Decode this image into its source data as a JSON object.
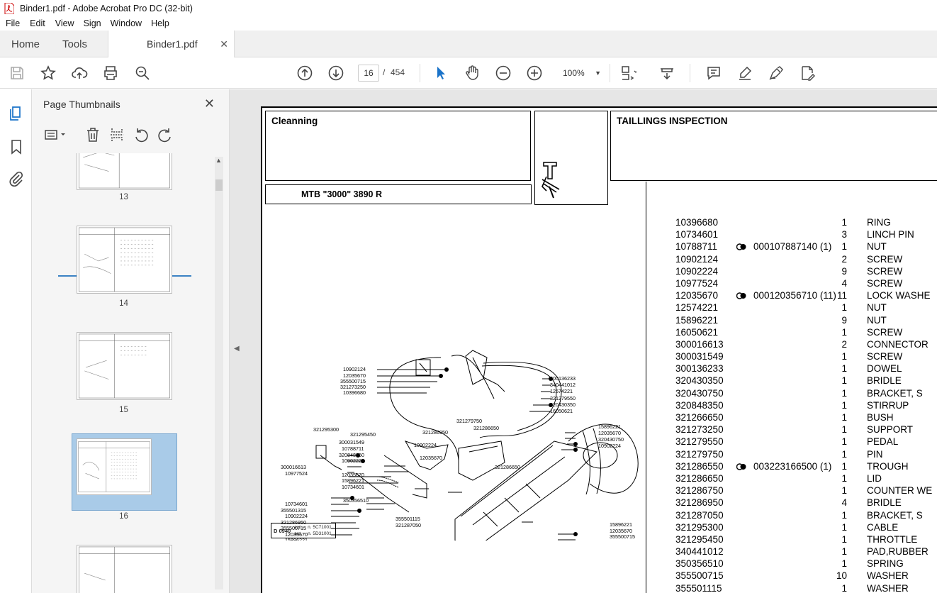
{
  "window": {
    "title": "Binder1.pdf - Adobe Acrobat Pro DC (32-bit)"
  },
  "menu": [
    "File",
    "Edit",
    "View",
    "Sign",
    "Window",
    "Help"
  ],
  "tabs": {
    "home": "Home",
    "tools": "Tools",
    "document": "Binder1.pdf"
  },
  "toolbar": {
    "current_page": "16",
    "separator": "/",
    "total_pages": "454",
    "zoom": "100%"
  },
  "panel": {
    "title": "Page Thumbnails",
    "thumbnails": [
      {
        "label": "13",
        "selected": false
      },
      {
        "label": "14",
        "selected": false
      },
      {
        "label": "15",
        "selected": false
      },
      {
        "label": "16",
        "selected": true
      },
      {
        "label": "",
        "selected": false
      }
    ]
  },
  "doc": {
    "section": "Cleanning",
    "heading": "TAILLINGS INSPECTION",
    "model": "MTB \"3000\" 3890 R",
    "drawing_code": "D 0940",
    "drawing_notes": [
      "aut.→ n. 5C71001",
      "aut.→ n. 5D31001"
    ],
    "parts": [
      {
        "pn": "10396680",
        "mark": false,
        "sub": "",
        "qty": "1",
        "desc": "RING"
      },
      {
        "pn": "10734601",
        "mark": false,
        "sub": "",
        "qty": "3",
        "desc": "LINCH PIN"
      },
      {
        "pn": "10788711",
        "mark": true,
        "sub": "000107887140  (1)",
        "qty": "1",
        "desc": "NUT"
      },
      {
        "pn": "10902124",
        "mark": false,
        "sub": "",
        "qty": "2",
        "desc": "SCREW"
      },
      {
        "pn": "10902224",
        "mark": false,
        "sub": "",
        "qty": "9",
        "desc": "SCREW"
      },
      {
        "pn": "10977524",
        "mark": false,
        "sub": "",
        "qty": "4",
        "desc": "SCREW"
      },
      {
        "pn": "12035670",
        "mark": true,
        "sub": "000120356710  (11)",
        "qty": "11",
        "desc": "LOCK WASHE"
      },
      {
        "pn": "12574221",
        "mark": false,
        "sub": "",
        "qty": "1",
        "desc": "NUT"
      },
      {
        "pn": "15896221",
        "mark": false,
        "sub": "",
        "qty": "9",
        "desc": "NUT"
      },
      {
        "pn": "16050621",
        "mark": false,
        "sub": "",
        "qty": "1",
        "desc": "SCREW"
      },
      {
        "pn": "300016613",
        "mark": false,
        "sub": "",
        "qty": "2",
        "desc": "CONNECTOR"
      },
      {
        "pn": "300031549",
        "mark": false,
        "sub": "",
        "qty": "1",
        "desc": "SCREW"
      },
      {
        "pn": "300136233",
        "mark": false,
        "sub": "",
        "qty": "1",
        "desc": "DOWEL"
      },
      {
        "pn": "320430350",
        "mark": false,
        "sub": "",
        "qty": "1",
        "desc": "BRIDLE"
      },
      {
        "pn": "320430750",
        "mark": false,
        "sub": "",
        "qty": "1",
        "desc": "BRACKET, S"
      },
      {
        "pn": "320848350",
        "mark": false,
        "sub": "",
        "qty": "1",
        "desc": "STIRRUP"
      },
      {
        "pn": "321266650",
        "mark": false,
        "sub": "",
        "qty": "1",
        "desc": "BUSH"
      },
      {
        "pn": "321273250",
        "mark": false,
        "sub": "",
        "qty": "1",
        "desc": "SUPPORT"
      },
      {
        "pn": "321279550",
        "mark": false,
        "sub": "",
        "qty": "1",
        "desc": "PEDAL"
      },
      {
        "pn": "321279750",
        "mark": false,
        "sub": "",
        "qty": "1",
        "desc": "PIN"
      },
      {
        "pn": "321286550",
        "mark": true,
        "sub": "003223166500  (1)",
        "qty": "1",
        "desc": "TROUGH"
      },
      {
        "pn": "321286650",
        "mark": false,
        "sub": "",
        "qty": "1",
        "desc": "LID"
      },
      {
        "pn": "321286750",
        "mark": false,
        "sub": "",
        "qty": "1",
        "desc": "COUNTER WE"
      },
      {
        "pn": "321286950",
        "mark": false,
        "sub": "",
        "qty": "4",
        "desc": "BRIDLE"
      },
      {
        "pn": "321287050",
        "mark": false,
        "sub": "",
        "qty": "1",
        "desc": "BRACKET, S"
      },
      {
        "pn": "321295300",
        "mark": false,
        "sub": "",
        "qty": "1",
        "desc": "CABLE"
      },
      {
        "pn": "321295450",
        "mark": false,
        "sub": "",
        "qty": "1",
        "desc": "THROTTLE"
      },
      {
        "pn": "340441012",
        "mark": false,
        "sub": "",
        "qty": "1",
        "desc": "PAD,RUBBER"
      },
      {
        "pn": "350356510",
        "mark": false,
        "sub": "",
        "qty": "1",
        "desc": "SPRING"
      },
      {
        "pn": "355500715",
        "mark": false,
        "sub": "",
        "qty": "10",
        "desc": "WASHER"
      },
      {
        "pn": "355501115",
        "mark": false,
        "sub": "",
        "qty": "1",
        "desc": "WASHER"
      }
    ],
    "diagram_labels": [
      "10902124",
      "12035670",
      "355500715",
      "321273250",
      "10396680",
      "300136233",
      "340441012",
      "12574221",
      "321279550",
      "320430350",
      "16050621",
      "321279750",
      "321286650",
      "321295300",
      "321295450",
      "321286950",
      "15896221",
      "12035670",
      "320430750",
      "10902224",
      "300031549",
      "10788711",
      "320848350",
      "10902224",
      "10902224",
      "12035670",
      "321286650",
      "300016613",
      "10977524",
      "12035670",
      "15896221",
      "10734601",
      "10734601",
      "355501315",
      "10902224",
      "321286950",
      "355500715",
      "12035670",
      "15896221",
      "321286750",
      "350356510",
      "355501115",
      "321287050",
      "15896221",
      "12035670",
      "355500715",
      "10902224",
      "321286550"
    ]
  }
}
